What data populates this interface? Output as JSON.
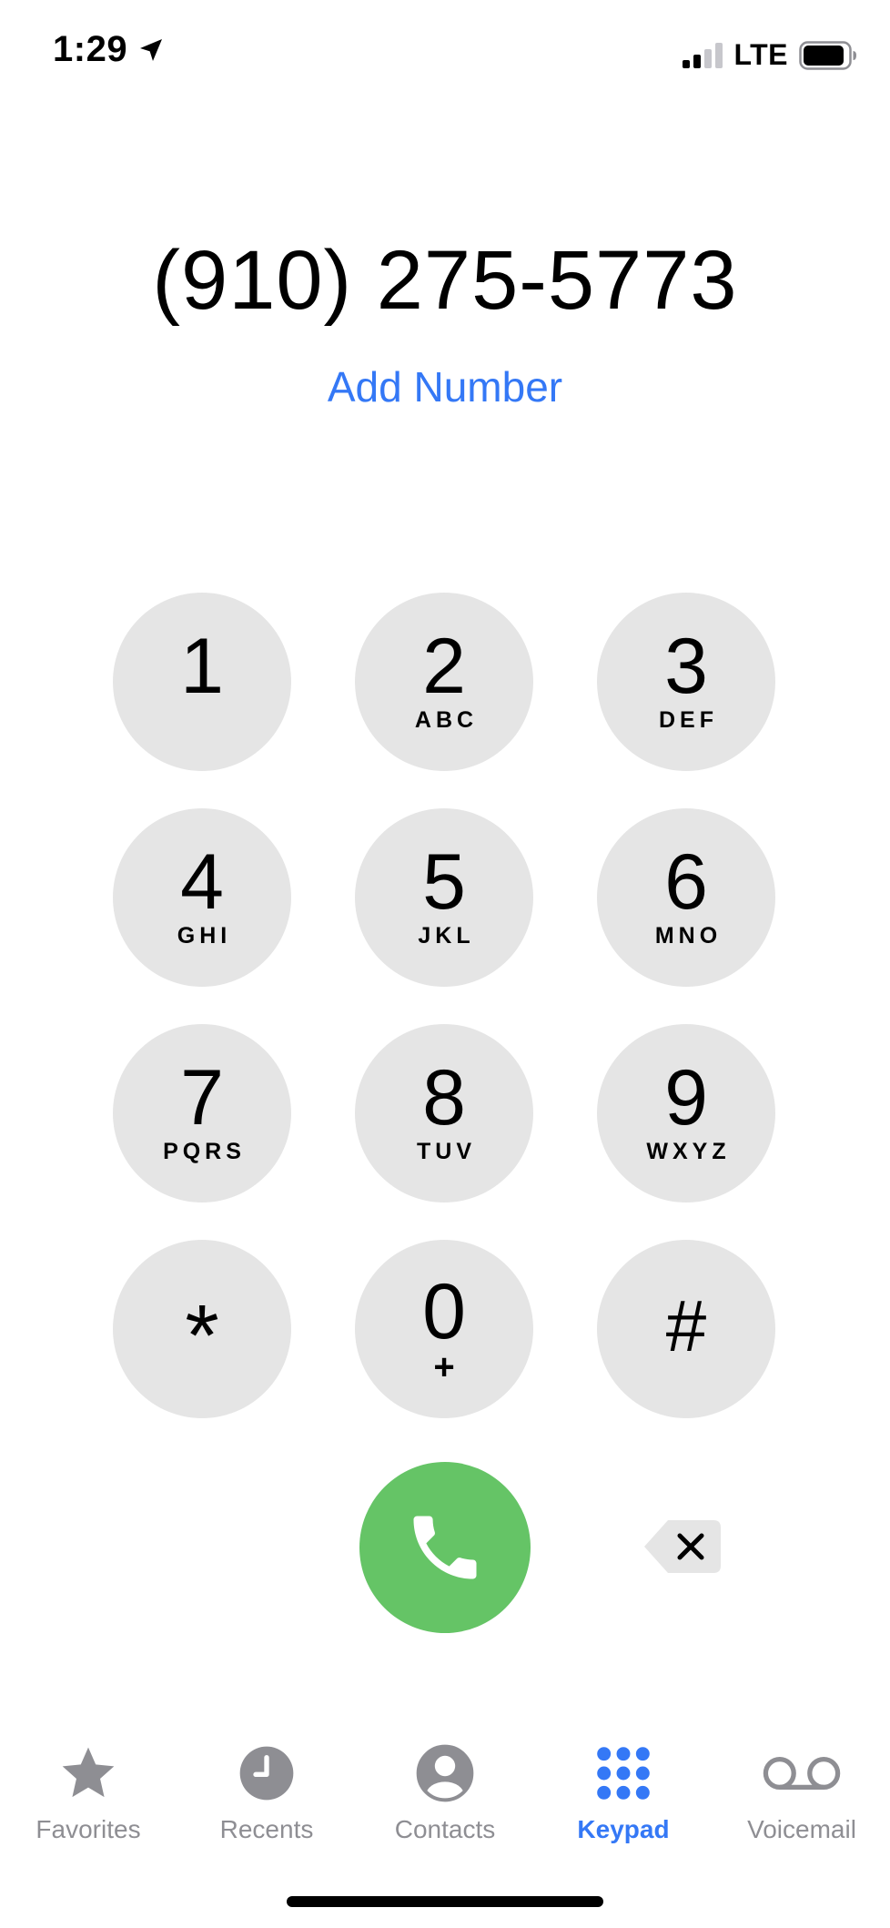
{
  "status_bar": {
    "time": "1:29",
    "network": "LTE",
    "signal_bars_active": 2,
    "signal_bars_total": 4,
    "battery_level": 0.85
  },
  "dialer": {
    "number": "(910) 275-5773",
    "add_number_label": "Add Number"
  },
  "keypad": {
    "keys": [
      {
        "digit": "1",
        "letters": ""
      },
      {
        "digit": "2",
        "letters": "ABC"
      },
      {
        "digit": "3",
        "letters": "DEF"
      },
      {
        "digit": "4",
        "letters": "GHI"
      },
      {
        "digit": "5",
        "letters": "JKL"
      },
      {
        "digit": "6",
        "letters": "MNO"
      },
      {
        "digit": "7",
        "letters": "PQRS"
      },
      {
        "digit": "8",
        "letters": "TUV"
      },
      {
        "digit": "9",
        "letters": "WXYZ"
      },
      {
        "digit": "*",
        "letters": ""
      },
      {
        "digit": "0",
        "letters": "+"
      },
      {
        "digit": "#",
        "letters": ""
      }
    ]
  },
  "tab_bar": {
    "tabs": [
      {
        "label": "Favorites",
        "icon": "star-icon",
        "active": false
      },
      {
        "label": "Recents",
        "icon": "clock-icon",
        "active": false
      },
      {
        "label": "Contacts",
        "icon": "person-circle-icon",
        "active": false
      },
      {
        "label": "Keypad",
        "icon": "keypad-grid-icon",
        "active": true
      },
      {
        "label": "Voicemail",
        "icon": "voicemail-icon",
        "active": false
      }
    ]
  },
  "colors": {
    "accent": "#3478f6",
    "call_green": "#65c466",
    "key_background": "#e5e5e5",
    "inactive_gray": "#8e8e93"
  }
}
